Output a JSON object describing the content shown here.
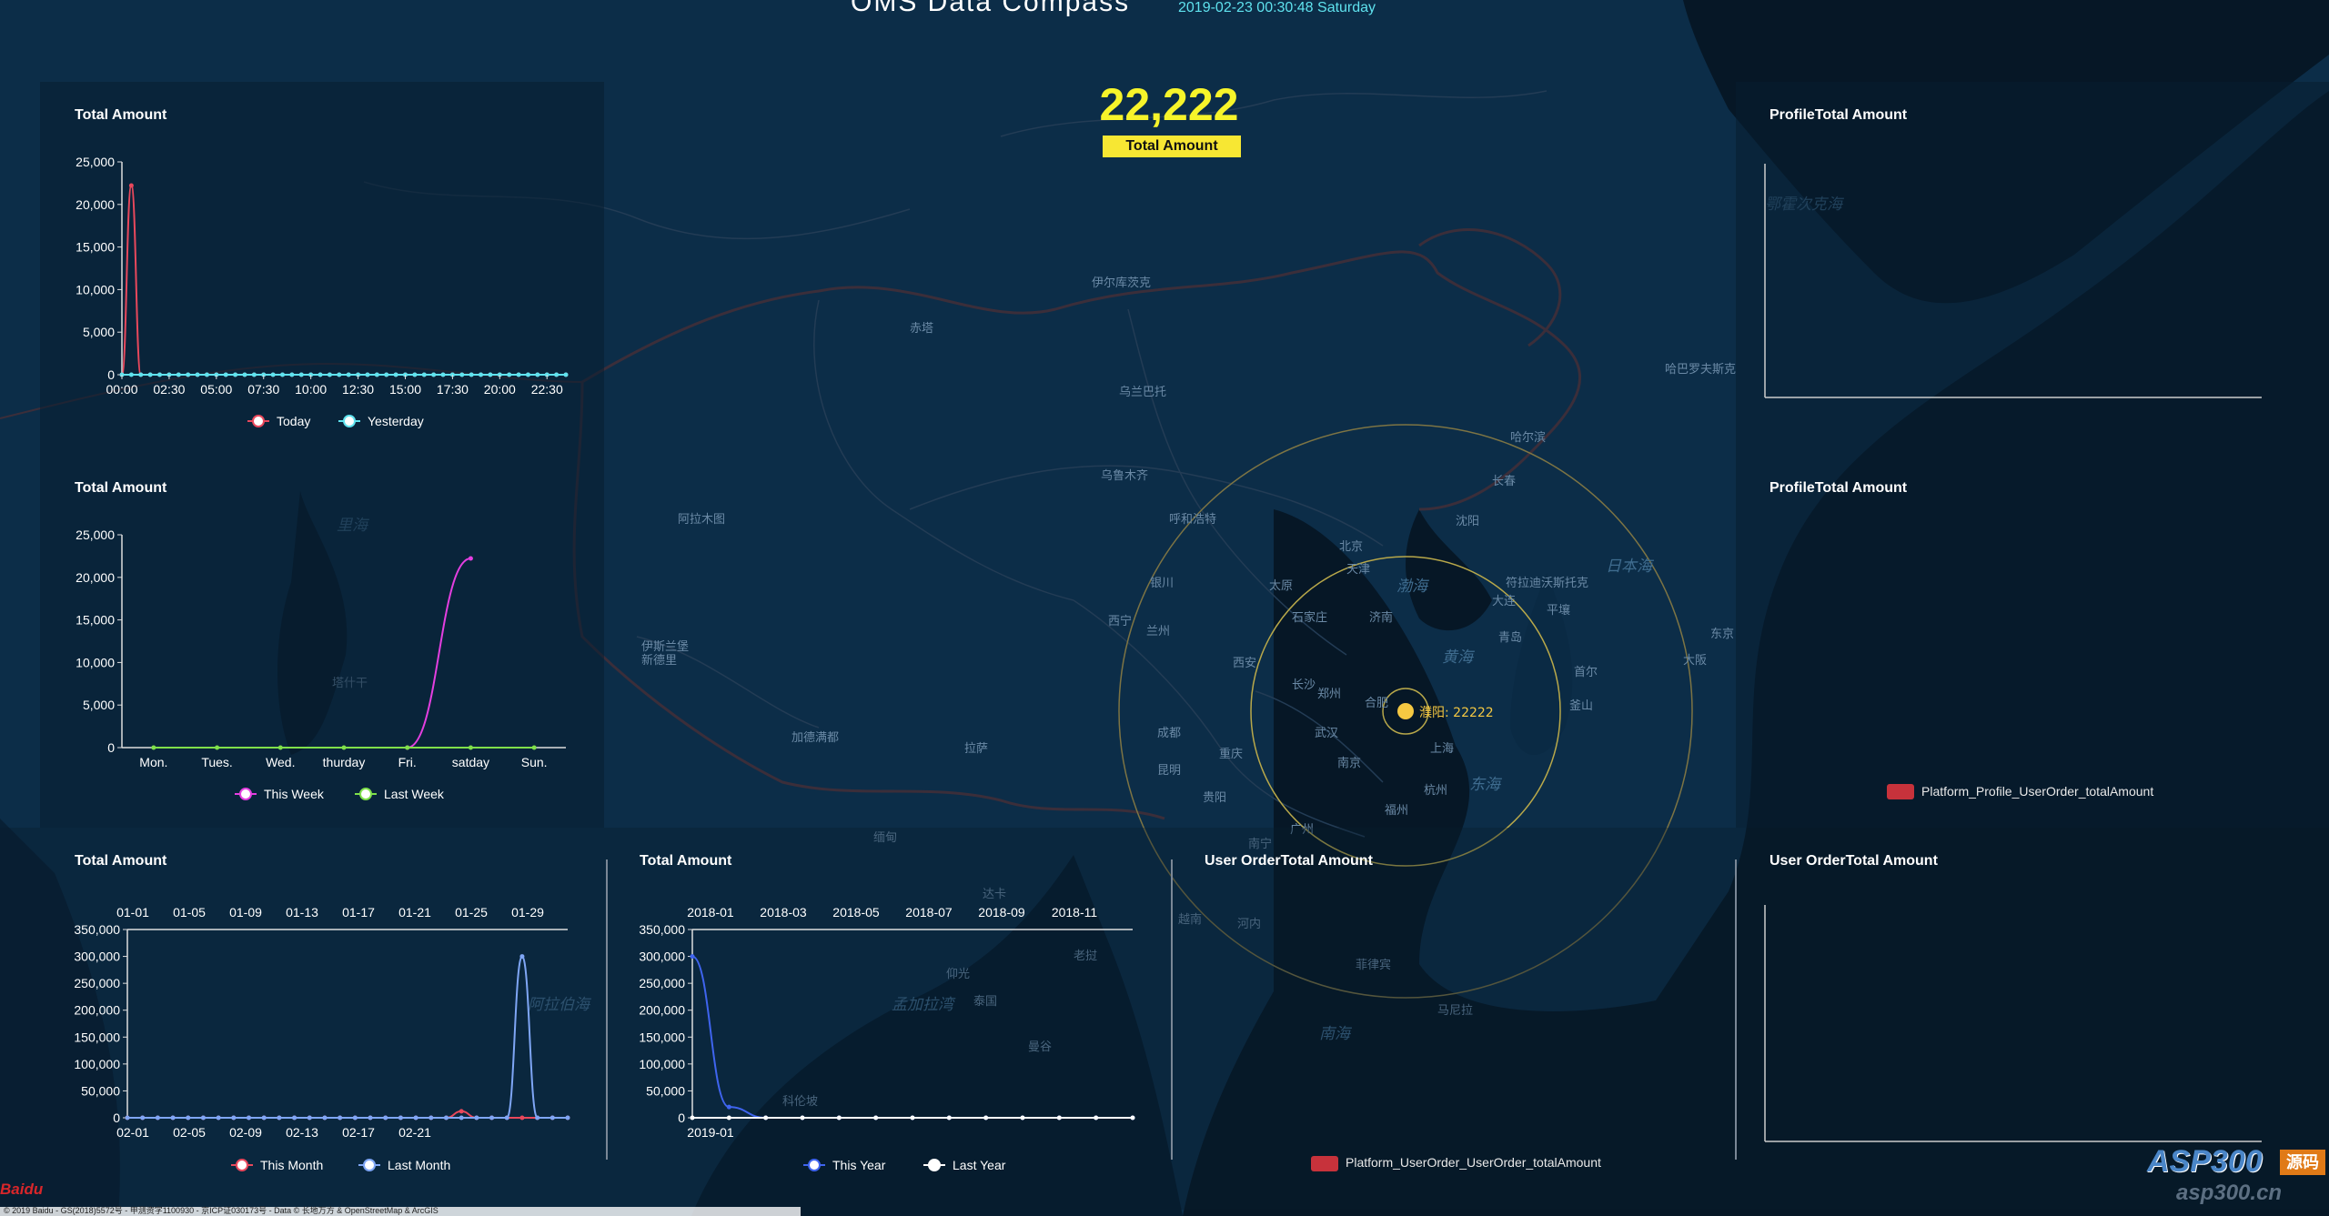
{
  "header": {
    "title": "OMS Data Compass",
    "datetime": "2019-02-23 00:30:48 Saturday"
  },
  "kpi": {
    "value": "22,222",
    "label": "Total Amount"
  },
  "map": {
    "marker_label": "濮阳: 22222",
    "places": [
      "北京",
      "天津",
      "渤海",
      "黄海",
      "东海",
      "日本海",
      "南海",
      "武汉",
      "西安",
      "长沙",
      "重庆",
      "成都",
      "南京",
      "上海",
      "沈阳",
      "长春",
      "哈尔滨",
      "乌鲁木齐",
      "拉萨",
      "兰州",
      "银川",
      "西宁",
      "昆明",
      "贵阳",
      "南宁",
      "广州",
      "福州",
      "杭州",
      "合肥",
      "济南",
      "石家庄",
      "太原",
      "郑州",
      "大连",
      "青岛",
      "首尔",
      "东京",
      "大阪",
      "釜山",
      "平壤",
      "乌兰巴托",
      "呼和浩特",
      "孟加拉湾",
      "阿拉伯海",
      "里海",
      "鄂霍次克海",
      "菲律宾",
      "越南",
      "缅甸",
      "泰国",
      "老挝",
      "新德里",
      "加德满都",
      "伊斯兰堡",
      "塔什干",
      "阿拉木图",
      "伊尔库茨克",
      "赤塔",
      "哈巴罗夫斯克",
      "符拉迪沃斯托克",
      "马尼拉",
      "河内",
      "曼谷",
      "仰光",
      "达卡",
      "科伦坡"
    ],
    "colors": {
      "marker": "#f5c842",
      "ring": "#b8a84a"
    }
  },
  "panels": {
    "p1_title": "Total Amount",
    "p2_title": "Total Amount",
    "p3_title": "Total Amount",
    "p4_title": "Total Amount",
    "p5_title": "User OrderTotal Amount",
    "p6_title": "User OrderTotal Amount",
    "r1_title": "ProfileTotal Amount",
    "r2_title": "ProfileTotal Amount",
    "r2_legend": "Platform_Profile_UserOrder_totalAmount",
    "p5_legend": "Platform_UserOrder_UserOrder_totalAmount"
  },
  "footer": {
    "baidu_logo": "Baidu",
    "copyright": "© 2019 Baidu - GS(2018)5572号 - 甲测资字1100930 - 京ICP证030173号 - Data © 长地万方 & OpenStreetMap & ArcGIS",
    "watermark_main": "ASP300",
    "watermark_tag": "源码",
    "watermark_url": "asp300.cn"
  },
  "chart_data": [
    {
      "type": "line",
      "title": "Total Amount",
      "x_ticks": [
        "00:00",
        "02:30",
        "05:00",
        "07:30",
        "10:00",
        "12:30",
        "15:00",
        "17:30",
        "20:00",
        "22:30"
      ],
      "ylim": [
        0,
        25000
      ],
      "y_ticks": [
        "0",
        "5,000",
        "10,000",
        "15,000",
        "20,000",
        "25,000"
      ],
      "x": [
        "00:00",
        "00:30",
        "01:00",
        "01:30",
        "02:00",
        "02:30",
        "03:00",
        "03:30",
        "04:00",
        "04:30",
        "05:00",
        "05:30",
        "06:00",
        "06:30",
        "07:00",
        "07:30",
        "08:00",
        "08:30",
        "09:00",
        "09:30",
        "10:00",
        "10:30",
        "11:00",
        "11:30",
        "12:00",
        "12:30",
        "13:00",
        "13:30",
        "14:00",
        "14:30",
        "15:00",
        "15:30",
        "16:00",
        "16:30",
        "17:00",
        "17:30",
        "18:00",
        "18:30",
        "19:00",
        "19:30",
        "20:00",
        "20:30",
        "21:00",
        "21:30",
        "22:00",
        "22:30",
        "23:00",
        "23:30"
      ],
      "series": [
        {
          "name": "Today",
          "color": "#e8485c",
          "values": [
            0,
            22222,
            0,
            0,
            0,
            0,
            0,
            0,
            0,
            0,
            0,
            0,
            0,
            0,
            0,
            0,
            0,
            0,
            0,
            0,
            0,
            0,
            0,
            0,
            0,
            0,
            0,
            0,
            0,
            0,
            0,
            0,
            0,
            0,
            0,
            0,
            0,
            0,
            0,
            0,
            0,
            0,
            0,
            0,
            0,
            0,
            0,
            0
          ]
        },
        {
          "name": "Yesterday",
          "color": "#5fe2ee",
          "values": [
            0,
            0,
            0,
            0,
            0,
            0,
            0,
            0,
            0,
            0,
            0,
            0,
            0,
            0,
            0,
            0,
            0,
            0,
            0,
            0,
            0,
            0,
            0,
            0,
            0,
            0,
            0,
            0,
            0,
            0,
            0,
            0,
            0,
            0,
            0,
            0,
            0,
            0,
            0,
            0,
            0,
            0,
            0,
            0,
            0,
            0,
            0,
            0
          ]
        }
      ]
    },
    {
      "type": "line",
      "title": "Total Amount",
      "categories": [
        "Mon.",
        "Tues.",
        "Wed.",
        "thurday",
        "Fri.",
        "satday",
        "Sun."
      ],
      "ylim": [
        0,
        25000
      ],
      "y_ticks": [
        "0",
        "5,000",
        "10,000",
        "15,000",
        "20,000",
        "25,000"
      ],
      "series": [
        {
          "name": "This Week",
          "color": "#e43fe0",
          "values": [
            null,
            null,
            null,
            null,
            0,
            22222,
            null
          ]
        },
        {
          "name": "Last Week",
          "color": "#7fe04a",
          "values": [
            0,
            0,
            0,
            0,
            0,
            0,
            0
          ]
        }
      ]
    },
    {
      "type": "line",
      "title": "Total Amount",
      "top_ticks": [
        "01-01",
        "01-05",
        "01-09",
        "01-13",
        "01-17",
        "01-21",
        "01-25",
        "01-29"
      ],
      "bottom_ticks": [
        "02-01",
        "02-05",
        "02-09",
        "02-13",
        "02-17",
        "02-21"
      ],
      "ylim": [
        0,
        350000
      ],
      "y_ticks": [
        "0",
        "50,000",
        "100,000",
        "150,000",
        "200,000",
        "250,000",
        "300,000",
        "350,000"
      ],
      "series": [
        {
          "name": "This Month",
          "color": "#e8485c",
          "values": [
            0,
            0,
            0,
            0,
            0,
            0,
            0,
            0,
            0,
            0,
            0,
            0,
            0,
            0,
            0,
            0,
            0,
            0,
            0,
            0,
            0,
            0,
            12000,
            0,
            0,
            0,
            0,
            0,
            0,
            0
          ]
        },
        {
          "name": "Last Month",
          "color": "#7fa6f5",
          "values": [
            0,
            0,
            0,
            0,
            0,
            0,
            0,
            0,
            0,
            0,
            0,
            0,
            0,
            0,
            0,
            0,
            0,
            0,
            0,
            0,
            0,
            0,
            0,
            0,
            0,
            0,
            300000,
            0,
            0,
            0
          ]
        }
      ]
    },
    {
      "type": "line",
      "title": "Total Amount",
      "top_ticks": [
        "2018-01",
        "2018-03",
        "2018-05",
        "2018-07",
        "2018-09",
        "2018-11"
      ],
      "bottom_ticks": [
        "2019-01"
      ],
      "ylim": [
        0,
        350000
      ],
      "y_ticks": [
        "0",
        "50,000",
        "100,000",
        "150,000",
        "200,000",
        "250,000",
        "300,000",
        "350,000"
      ],
      "series": [
        {
          "name": "This Year",
          "color": "#3f64ee",
          "values": [
            300000,
            20000,
            0,
            0,
            0,
            0,
            0,
            0,
            0,
            0,
            0,
            0,
            0
          ]
        },
        {
          "name": "Last Year",
          "color": "#ffffff",
          "values": [
            0,
            0,
            0,
            0,
            0,
            0,
            0,
            0,
            0,
            0,
            0,
            0,
            0
          ]
        }
      ]
    }
  ]
}
